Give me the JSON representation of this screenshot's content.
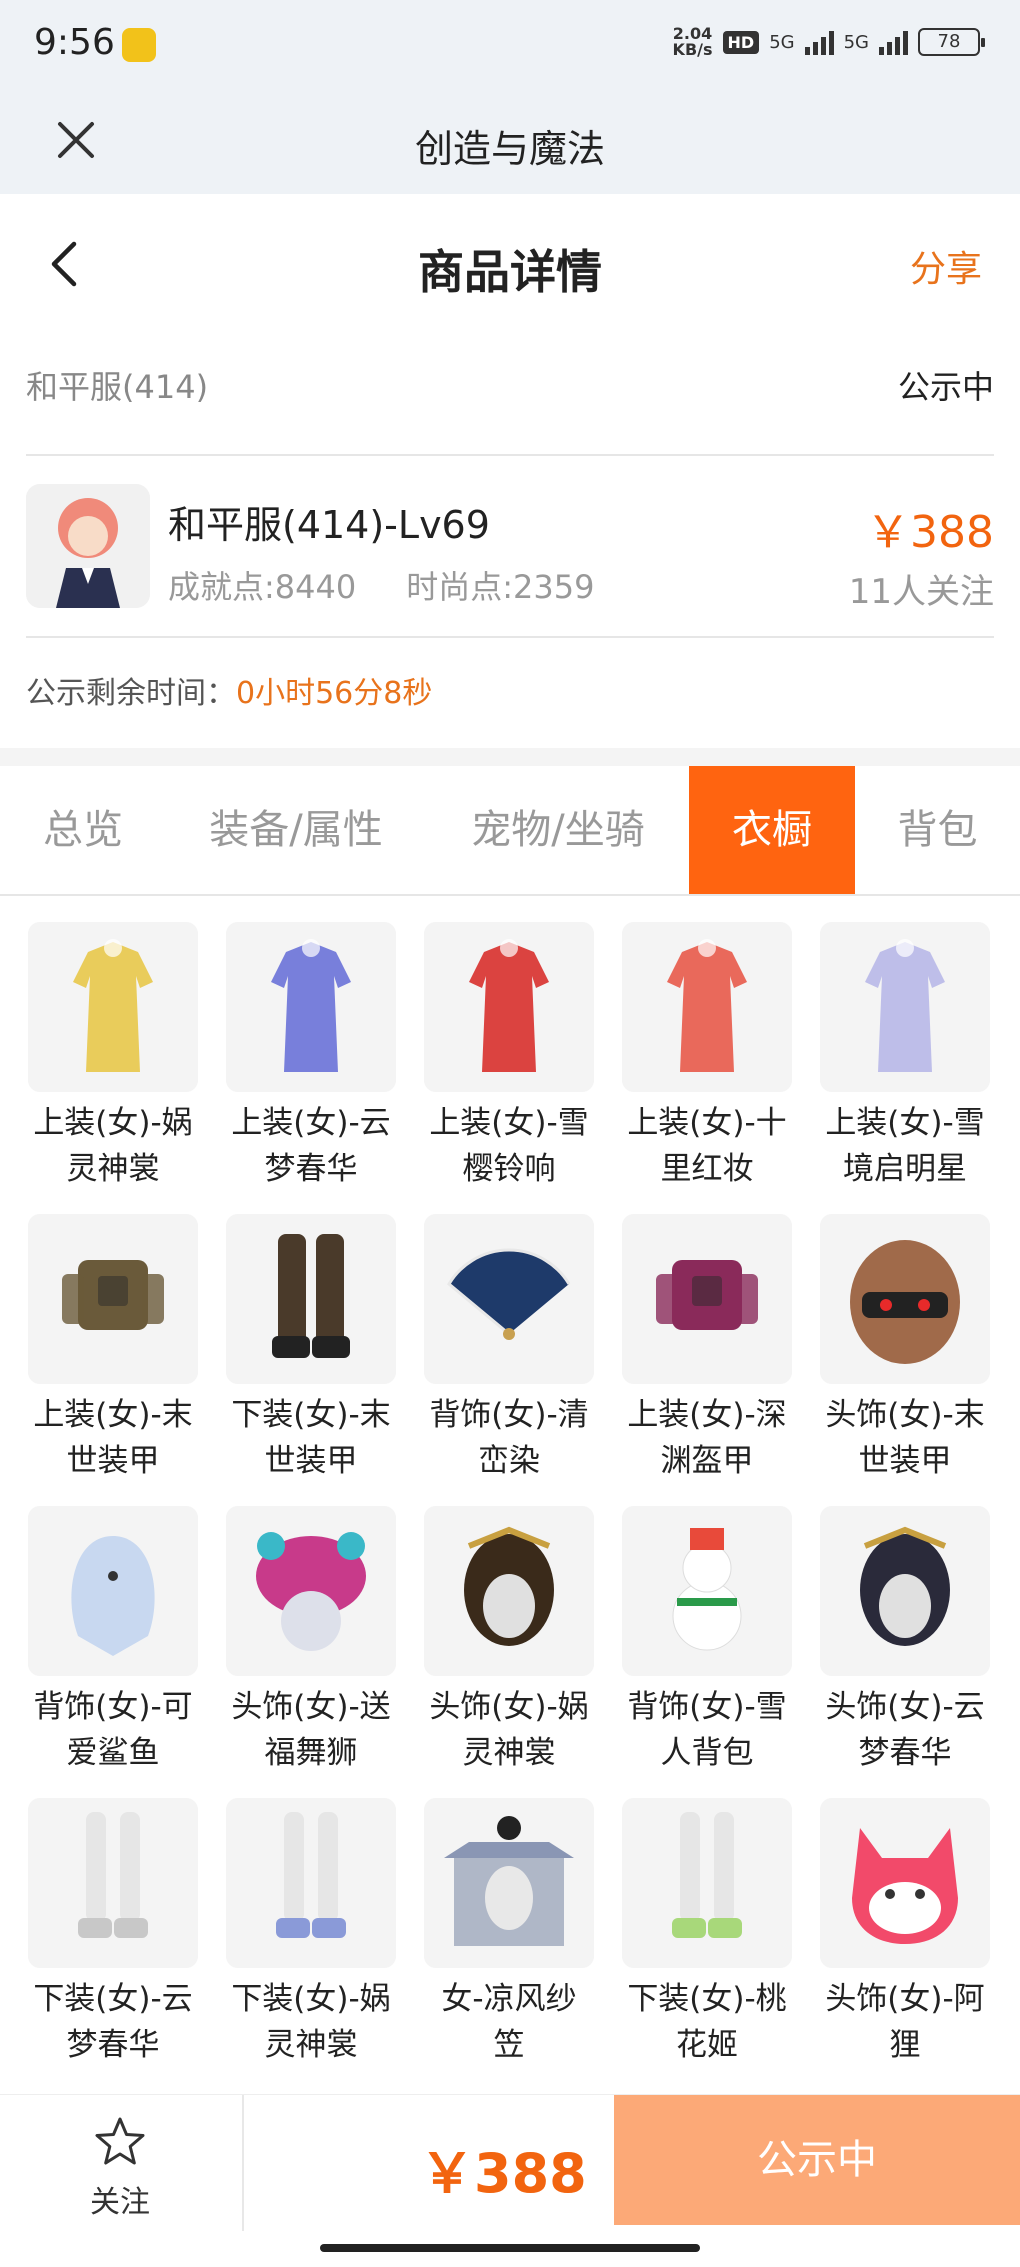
{
  "status_bar": {
    "time": "9:56",
    "net_speed_value": "2.04",
    "net_speed_unit": "KB/s",
    "hd_label": "HD",
    "signal1_label": "5G",
    "signal2_label": "5G",
    "battery": "78"
  },
  "app_bar": {
    "title": "创造与魔法"
  },
  "header": {
    "title": "商品详情",
    "share_label": "分享"
  },
  "server_row": {
    "name": "和平服(414)",
    "status": "公示中"
  },
  "product": {
    "name": "和平服(414)-Lv69",
    "achievement": "成就点:8440",
    "fashion": "时尚点:2359",
    "price": "￥388",
    "followers": "11人关注"
  },
  "countdown": {
    "label": "公示剩余时间：",
    "value": "0小时56分8秒"
  },
  "tabs": [
    {
      "label": "总览"
    },
    {
      "label": "装备/属性"
    },
    {
      "label": "宠物/坐骑"
    },
    {
      "label": "衣橱"
    },
    {
      "label": "背包"
    }
  ],
  "active_tab": "衣橱",
  "wardrobe": [
    {
      "line1": "上装(女)-娲",
      "line2": "灵神裳",
      "icon": "outfit-icon",
      "color": "#e8c84a"
    },
    {
      "line1": "上装(女)-云",
      "line2": "梦春华",
      "icon": "outfit-icon",
      "color": "#6a72d8"
    },
    {
      "line1": "上装(女)-雪",
      "line2": "樱铃响",
      "icon": "outfit-icon",
      "color": "#d8302c"
    },
    {
      "line1": "上装(女)-十",
      "line2": "里红妆",
      "icon": "outfit-icon",
      "color": "#e85a4a"
    },
    {
      "line1": "上装(女)-雪",
      "line2": "境启明星",
      "icon": "outfit-icon",
      "color": "#b8b8e8"
    },
    {
      "line1": "上装(女)-末",
      "line2": "世装甲",
      "icon": "armor-icon",
      "color": "#6a5a3a"
    },
    {
      "line1": "下装(女)-末",
      "line2": "世装甲",
      "icon": "boots-icon",
      "color": "#4a3a2a"
    },
    {
      "line1": "背饰(女)-清",
      "line2": "峦染",
      "icon": "fan-icon",
      "color": "#1e3a6a"
    },
    {
      "line1": "上装(女)-深",
      "line2": "渊盔甲",
      "icon": "armor-icon",
      "color": "#8a2a5a"
    },
    {
      "line1": "头饰(女)-末",
      "line2": "世装甲",
      "icon": "helmet-icon",
      "color": "#a06a4a"
    },
    {
      "line1": "背饰(女)-可",
      "line2": "爱鲨鱼",
      "icon": "shark-icon",
      "color": "#c8d8f0"
    },
    {
      "line1": "头饰(女)-送",
      "line2": "福舞狮",
      "icon": "lion-icon",
      "color": "#c83a8a"
    },
    {
      "line1": "头饰(女)-娲",
      "line2": "灵神裳",
      "icon": "headdress-icon",
      "color": "#3a2a1a"
    },
    {
      "line1": "背饰(女)-雪",
      "line2": "人背包",
      "icon": "snowman-icon",
      "color": "#e84a3a"
    },
    {
      "line1": "头饰(女)-云",
      "line2": "梦春华",
      "icon": "headdress-icon",
      "color": "#2a2a3a"
    },
    {
      "line1": "下装(女)-云",
      "line2": "梦春华",
      "icon": "legs-icon",
      "color": "#c8c8c8"
    },
    {
      "line1": "下装(女)-娲",
      "line2": "灵神裳",
      "icon": "legs-icon",
      "color": "#8a9ad8"
    },
    {
      "line1": "女-凉风纱",
      "line2": "笠",
      "icon": "hat-icon",
      "color": "#6a7a9a"
    },
    {
      "line1": "下装(女)-桃",
      "line2": "花姬",
      "icon": "legs-icon",
      "color": "#a8d87a"
    },
    {
      "line1": "头饰(女)-阿",
      "line2": "狸",
      "icon": "fox-mask-icon",
      "color": "#f24a6a"
    }
  ],
  "bottom_bar": {
    "follow_label": "关注",
    "price": "￥388",
    "status_label": "公示中"
  },
  "colors": {
    "accent": "#ff6410",
    "price": "#f2640f",
    "status_button": "#fca977"
  }
}
